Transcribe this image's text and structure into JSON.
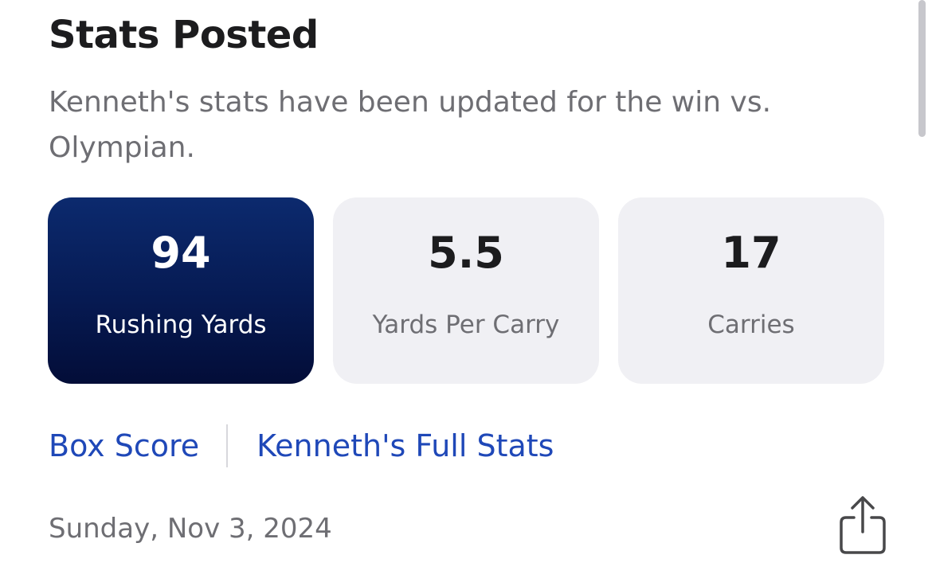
{
  "card": {
    "title": "Stats Posted",
    "subtitle": "Kenneth's stats have been updated for the win vs. Olympian.",
    "stats": [
      {
        "value": "94",
        "label": "Rushing Yards"
      },
      {
        "value": "5.5",
        "label": "Yards Per Carry"
      },
      {
        "value": "17",
        "label": "Carries"
      }
    ],
    "links": {
      "box_score": "Box Score",
      "full_stats": "Kenneth's Full Stats"
    },
    "date": "Sunday, Nov 3, 2024",
    "share_icon": "share-icon"
  },
  "colors": {
    "primary_card": "#061a52",
    "link": "#1f48b8",
    "secondary_text": "#6e6e73",
    "stat_card_bg": "#f0f0f4"
  }
}
